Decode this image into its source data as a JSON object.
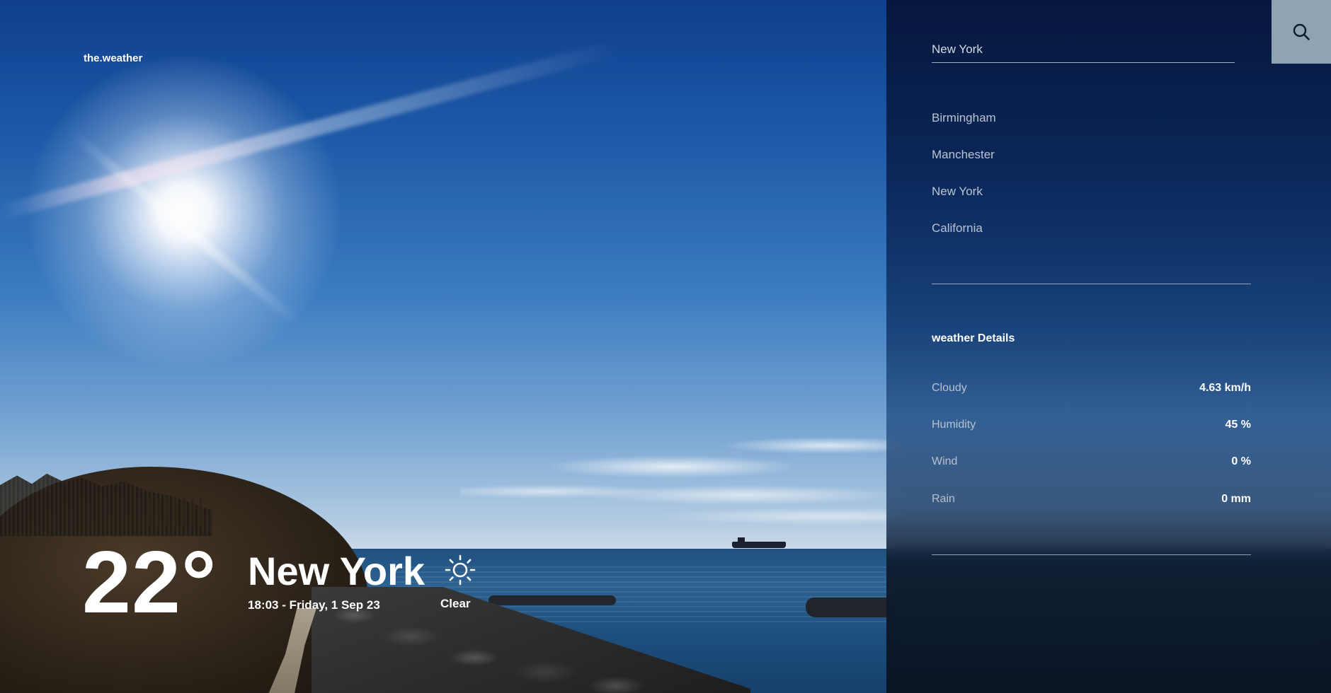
{
  "app": {
    "logo": "the.weather"
  },
  "current": {
    "temperature": "22°",
    "city": "New York",
    "datetime": "18:03 - Friday, 1 Sep 23",
    "condition": "Clear",
    "condition_icon": "sun-icon"
  },
  "search": {
    "value": "New York",
    "button_icon": "search-icon"
  },
  "cities": [
    "Birmingham",
    "Manchester",
    "New York",
    "California"
  ],
  "details": {
    "title": "weather Details",
    "rows": [
      {
        "label": "Cloudy",
        "value": "4.63 km/h"
      },
      {
        "label": "Humidity",
        "value": "45 %"
      },
      {
        "label": "Wind",
        "value": "0 %"
      },
      {
        "label": "Rain",
        "value": "0 mm"
      }
    ]
  },
  "colors": {
    "sidebar": "#0a2050",
    "search_button": "#8fa3b4",
    "text": "#ffffff",
    "muted_text": "#b9c4d2"
  }
}
